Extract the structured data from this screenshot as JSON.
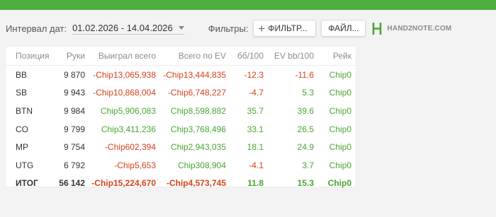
{
  "colors": {
    "topbar": "#4cae3c",
    "positive": "#4aa534",
    "negative": "#d3431a",
    "logo": "#4aa534"
  },
  "toolbar": {
    "interval_label": "Интервал дат:",
    "date_range": "01.02.2026 - 14.04.2026",
    "filters_label": "Фильтры:",
    "filter_button": "ФИЛЬТР...",
    "file_button": "ФАЙЛ...",
    "logo_text": "HAND2NOTE.COM"
  },
  "table": {
    "headers": [
      "Позиция",
      "Руки",
      "Выиграл всего",
      "Всего по EV",
      "бб/100",
      "EV bb/100",
      "Рейк"
    ],
    "rows": [
      {
        "pos": "BB",
        "hands": "9 870",
        "won": "-Chip13,065,938",
        "ev": "-Chip13,444,835",
        "bb100": "-12.3",
        "evbb100": "-11.6",
        "rake": "Chip0"
      },
      {
        "pos": "SB",
        "hands": "9 943",
        "won": "-Chip10,868,004",
        "ev": "-Chip6,748,227",
        "bb100": "-4.7",
        "evbb100": "5.3",
        "rake": "Chip0"
      },
      {
        "pos": "BTN",
        "hands": "9 984",
        "won": "Chip5,906,083",
        "ev": "Chip8,598,882",
        "bb100": "35.7",
        "evbb100": "39.6",
        "rake": "Chip0"
      },
      {
        "pos": "CO",
        "hands": "9 799",
        "won": "Chip3,411,236",
        "ev": "Chip3,768,496",
        "bb100": "33.1",
        "evbb100": "26.5",
        "rake": "Chip0"
      },
      {
        "pos": "MP",
        "hands": "9 754",
        "won": "-Chip602,394",
        "ev": "Chip2,943,035",
        "bb100": "18.1",
        "evbb100": "24.9",
        "rake": "Chip0"
      },
      {
        "pos": "UTG",
        "hands": "6 792",
        "won": "-Chip5,653",
        "ev": "Chip308,904",
        "bb100": "-4.1",
        "evbb100": "3.7",
        "rake": "Chip0"
      }
    ],
    "total": {
      "pos": "ИТОГ",
      "hands": "56 142",
      "won": "-Chip15,224,670",
      "ev": "-Chip4,573,745",
      "bb100": "11.8",
      "evbb100": "15.3",
      "rake": "Chip0"
    }
  }
}
